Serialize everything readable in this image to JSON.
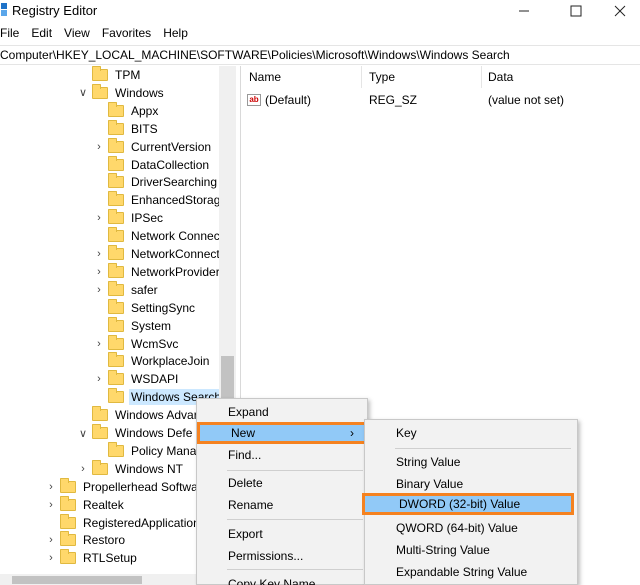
{
  "window": {
    "title": "Registry Editor",
    "minimize_icon": "minimize-icon",
    "maximize_icon": "maximize-icon",
    "close_icon": "close-icon"
  },
  "menubar": [
    "File",
    "Edit",
    "View",
    "Favorites",
    "Help"
  ],
  "address": "Computer\\HKEY_LOCAL_MACHINE\\SOFTWARE\\Policies\\Microsoft\\Windows\\Windows Search",
  "tree": [
    {
      "label": "TPM",
      "expander": "",
      "depth": 2
    },
    {
      "label": "Windows",
      "expander": "v",
      "depth": 2
    },
    {
      "label": "Appx",
      "expander": "",
      "depth": 3
    },
    {
      "label": "BITS",
      "expander": "",
      "depth": 3
    },
    {
      "label": "CurrentVersion",
      "expander": ">",
      "depth": 3
    },
    {
      "label": "DataCollection",
      "expander": "",
      "depth": 3
    },
    {
      "label": "DriverSearching",
      "expander": "",
      "depth": 3
    },
    {
      "label": "EnhancedStorage",
      "expander": "",
      "depth": 3
    },
    {
      "label": "IPSec",
      "expander": ">",
      "depth": 3
    },
    {
      "label": "Network Connect",
      "expander": "",
      "depth": 3
    },
    {
      "label": "NetworkConnect",
      "expander": ">",
      "depth": 3
    },
    {
      "label": "NetworkProvider",
      "expander": ">",
      "depth": 3
    },
    {
      "label": "safer",
      "expander": ">",
      "depth": 3
    },
    {
      "label": "SettingSync",
      "expander": "",
      "depth": 3
    },
    {
      "label": "System",
      "expander": "",
      "depth": 3
    },
    {
      "label": "WcmSvc",
      "expander": ">",
      "depth": 3
    },
    {
      "label": "WorkplaceJoin",
      "expander": "",
      "depth": 3
    },
    {
      "label": "WSDAPI",
      "expander": ">",
      "depth": 3
    },
    {
      "label": "Windows Search",
      "expander": "",
      "depth": 3,
      "selected": true
    },
    {
      "label": "Windows Advar",
      "expander": "",
      "depth": 2
    },
    {
      "label": "Windows Defe",
      "expander": "v",
      "depth": 2
    },
    {
      "label": "Policy Mana",
      "expander": "",
      "depth": 3
    },
    {
      "label": "Windows NT",
      "expander": ">",
      "depth": 2
    },
    {
      "label": "Propellerhead Softwa",
      "expander": ">",
      "depth": 1
    },
    {
      "label": "Realtek",
      "expander": ">",
      "depth": 1
    },
    {
      "label": "RegisteredApplication",
      "expander": "",
      "depth": 1
    },
    {
      "label": "Restoro",
      "expander": ">",
      "depth": 1
    },
    {
      "label": "RTLSetup",
      "expander": ">",
      "depth": 1
    }
  ],
  "list": {
    "columns": [
      "Name",
      "Type",
      "Data"
    ],
    "rows": [
      {
        "icon": "string-value-icon",
        "icon_text": "ab",
        "name": "(Default)",
        "type": "REG_SZ",
        "data": "(value not set)"
      }
    ]
  },
  "context_menu": {
    "items": [
      "Expand",
      "New",
      "Find...",
      "Delete",
      "Rename",
      "Export",
      "Permissions...",
      "Copy Key Name"
    ],
    "new_arrow": ">",
    "highlighted": "New"
  },
  "submenu": {
    "items": [
      "Key",
      "String Value",
      "Binary Value",
      "DWORD (32-bit) Value",
      "QWORD (64-bit) Value",
      "Multi-String Value",
      "Expandable String Value"
    ],
    "highlighted": "DWORD (32-bit) Value"
  },
  "colors": {
    "highlight_fill": "#91c9f7",
    "highlight_border": "#f58220",
    "folder": "#ffd86b",
    "selected_tree": "#cce8ff"
  }
}
